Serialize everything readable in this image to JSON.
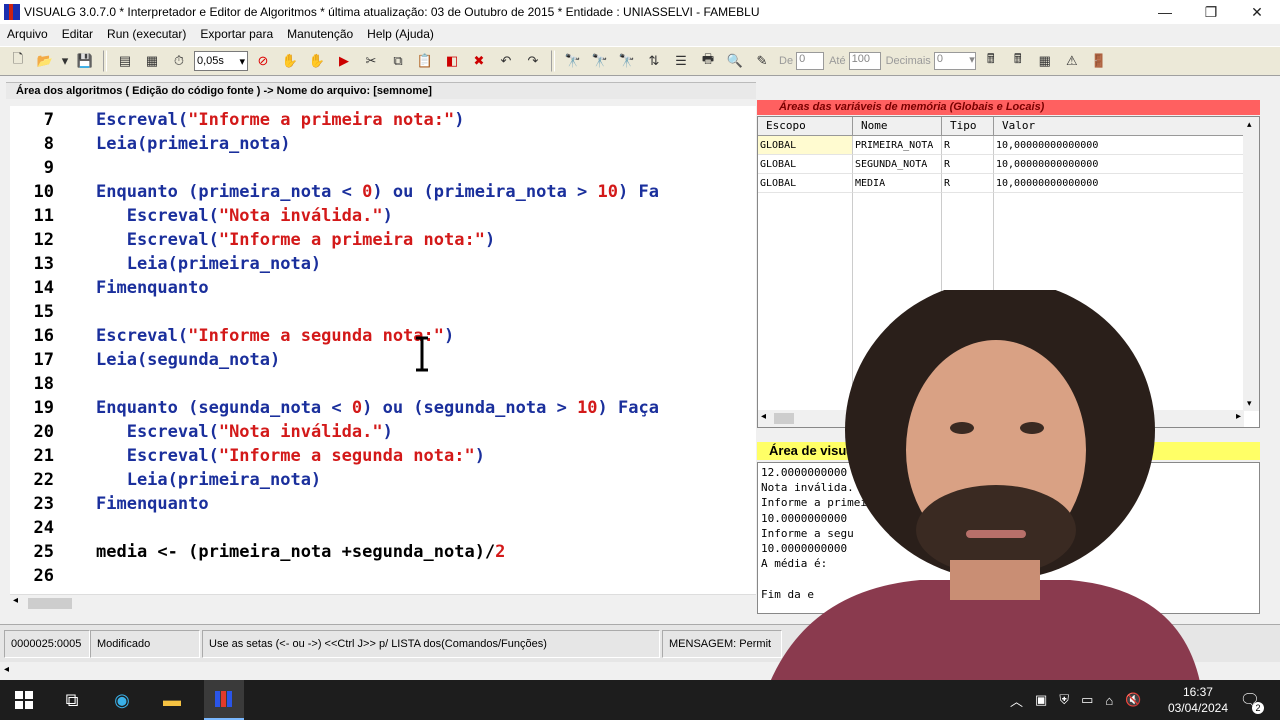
{
  "window": {
    "title": "VISUALG 3.0.7.0 * Interpretador e Editor de Algoritmos * última atualização: 03 de Outubro de 2015 * Entidade : UNIASSELVI - FAMEBLU",
    "min": "—",
    "max": "❐",
    "close": "✕"
  },
  "menu": [
    "Arquivo",
    "Editar",
    "Run (executar)",
    "Exportar para",
    "Manutenção",
    "Help (Ajuda)"
  ],
  "toolbar": {
    "speed": "0,05s",
    "de_label": "De",
    "de_value": "0",
    "ate_label": "Até",
    "ate_value": "100",
    "decimais_label": "Decimais",
    "decimais_value": "0"
  },
  "editor": {
    "header": "Área dos algoritmos ( Edição do código fonte ) -> Nome do arquivo: [semnome]",
    "lines": [
      {
        "n": "7",
        "segs": [
          [
            "ind",
            ""
          ],
          [
            "kw",
            "Escreval("
          ],
          [
            "str",
            "\"Informe a primeira nota:\""
          ],
          [
            "kw",
            ")"
          ]
        ]
      },
      {
        "n": "8",
        "segs": [
          [
            "kw",
            "Leia(primeira_nota)"
          ]
        ]
      },
      {
        "n": "9",
        "segs": []
      },
      {
        "n": "10",
        "segs": [
          [
            "kw",
            "Enquanto (primeira_nota < "
          ],
          [
            "num",
            "0"
          ],
          [
            "kw",
            ") ou (primeira_nota > "
          ],
          [
            "num",
            "10"
          ],
          [
            "kw",
            ") Fa"
          ]
        ]
      },
      {
        "n": "11",
        "segs": [
          [
            "kw",
            "   Escreval("
          ],
          [
            "str",
            "\"Nota inválida.\""
          ],
          [
            "kw",
            ")"
          ]
        ]
      },
      {
        "n": "12",
        "segs": [
          [
            "kw",
            "   Escreval("
          ],
          [
            "str",
            "\"Informe a primeira nota:\""
          ],
          [
            "kw",
            ")"
          ]
        ]
      },
      {
        "n": "13",
        "segs": [
          [
            "kw",
            "   Leia(primeira_nota)"
          ]
        ]
      },
      {
        "n": "14",
        "segs": [
          [
            "kw",
            "Fimenquanto"
          ]
        ]
      },
      {
        "n": "15",
        "segs": []
      },
      {
        "n": "16",
        "segs": [
          [
            "kw",
            "Escreval("
          ],
          [
            "str",
            "\"Informe a segunda nota:\""
          ],
          [
            "kw",
            ")"
          ]
        ]
      },
      {
        "n": "17",
        "segs": [
          [
            "kw",
            "Leia(segunda_nota)"
          ]
        ]
      },
      {
        "n": "18",
        "segs": []
      },
      {
        "n": "19",
        "segs": [
          [
            "kw",
            "Enquanto (segunda_nota < "
          ],
          [
            "num",
            "0"
          ],
          [
            "kw",
            ") ou (segunda_nota > "
          ],
          [
            "num",
            "10"
          ],
          [
            "kw",
            ") Faça"
          ]
        ]
      },
      {
        "n": "20",
        "segs": [
          [
            "kw",
            "   Escreval("
          ],
          [
            "str",
            "\"Nota inválida.\""
          ],
          [
            "kw",
            ")"
          ]
        ]
      },
      {
        "n": "21",
        "segs": [
          [
            "kw",
            "   Escreval("
          ],
          [
            "str",
            "\"Informe a segunda nota:\""
          ],
          [
            "kw",
            ")"
          ]
        ]
      },
      {
        "n": "22",
        "segs": [
          [
            "kw",
            "   Leia(primeira_nota)"
          ]
        ]
      },
      {
        "n": "23",
        "segs": [
          [
            "kw",
            "Fimenquanto"
          ]
        ]
      },
      {
        "n": "24",
        "segs": []
      },
      {
        "n": "25",
        "segs": [
          [
            "plain",
            "media <- (primeira_nota +segunda_nota)/"
          ],
          [
            "num",
            "2"
          ]
        ]
      },
      {
        "n": "26",
        "segs": []
      }
    ]
  },
  "variables": {
    "header": "Áreas das variáveis de memória (Globais e Locais)",
    "columns": [
      "Escopo",
      "Nome",
      "Tipo",
      "Valor"
    ],
    "rows": [
      [
        "GLOBAL",
        "PRIMEIRA_NOTA",
        "R",
        "10,00000000000000"
      ],
      [
        "GLOBAL",
        "SEGUNDA_NOTA",
        "R",
        "10,00000000000000"
      ],
      [
        "GLOBAL",
        "MEDIA",
        "R",
        "10,00000000000000"
      ]
    ]
  },
  "output": {
    "header": "Área de visualização dos",
    "lines": [
      "12.0000000000",
      "Nota inválida.",
      "Informe a primeira",
      "10.0000000000",
      "Informe a segu",
      "10.0000000000",
      "A média é:",
      "",
      "Fim da e"
    ]
  },
  "status": {
    "position": "0000025:0005",
    "state": "Modificado",
    "hint": "Use as setas (<- ou ->) <<Ctrl J>> p/ LISTA dos(Comandos/Funções)",
    "message": "MENSAGEM: Permit"
  },
  "taskbar": {
    "time": "16:37",
    "date": "03/04/2024",
    "notif_count": "2"
  },
  "colors": {
    "keyword": "#1a2f9c",
    "string": "#d31919",
    "var_header": "#ff6060",
    "output_header": "#ffff66"
  }
}
